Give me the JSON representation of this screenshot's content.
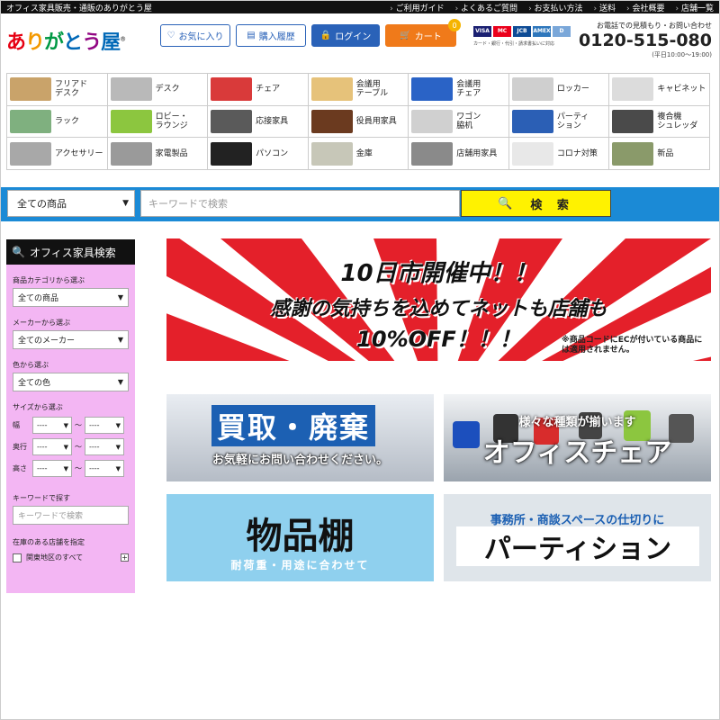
{
  "topbar": {
    "tagline": "オフィス家具販売・通販のありがとう屋",
    "links": [
      "ご利用ガイド",
      "よくあるご質問",
      "お支払い方法",
      "送料",
      "会社概要",
      "店舗一覧"
    ]
  },
  "header": {
    "logo": {
      "a": "あ",
      "ri": "り",
      "ga": "が",
      "to": "と",
      "u": "う",
      "ya": "屋",
      "mark": "®"
    },
    "fav_label": "お気に入り",
    "history_label": "購入履歴",
    "login_label": "ログイン",
    "cart_label": "カート",
    "cart_count": "0",
    "cards": [
      "VISA",
      "MC",
      "JCB",
      "AMEX",
      "D"
    ],
    "card_note": "カード・銀行・代引・請求書払いに対応",
    "phone_label": "お電話での見積もり・お問い合わせ",
    "phone_number": "0120-515-080",
    "phone_hours": "(平日10:00～19:00)"
  },
  "categories": [
    {
      "label": "フリアド\nデスク",
      "color": "#c9a36a"
    },
    {
      "label": "デスク",
      "color": "#b9b9b9"
    },
    {
      "label": "チェア",
      "color": "#d93a3a"
    },
    {
      "label": "会議用\nテーブル",
      "color": "#e6c27a"
    },
    {
      "label": "会議用\nチェア",
      "color": "#2a63c6"
    },
    {
      "label": "ロッカー",
      "color": "#cfcfcf"
    },
    {
      "label": "キャビネット",
      "color": "#dcdcdc"
    },
    {
      "label": "ラック",
      "color": "#7fb07f"
    },
    {
      "label": "ロビー・\nラウンジ",
      "color": "#8cc63f"
    },
    {
      "label": "応接家具",
      "color": "#5a5a5a"
    },
    {
      "label": "役員用家具",
      "color": "#6b3a1f"
    },
    {
      "label": "ワゴン\n脇机",
      "color": "#d0d0d0"
    },
    {
      "label": "パーティ\nション",
      "color": "#2b5fb5"
    },
    {
      "label": "複合機\nシュレッダ",
      "color": "#4a4a4a"
    },
    {
      "label": "アクセサリー",
      "color": "#a8a8a8"
    },
    {
      "label": "家電製品",
      "color": "#9a9a9a"
    },
    {
      "label": "パソコン",
      "color": "#222222"
    },
    {
      "label": "金庫",
      "color": "#c7c7b8"
    },
    {
      "label": "店舗用家具",
      "color": "#8a8a8a"
    },
    {
      "label": "コロナ対策",
      "color": "#e8e8e8"
    },
    {
      "label": "新品",
      "color": "#8a9a6a"
    }
  ],
  "search": {
    "category_value": "全ての商品",
    "keyword_placeholder": "キーワードで検索",
    "button_label": "検 索"
  },
  "sidebar": {
    "title": "オフィス家具検索",
    "category_label": "商品カテゴリから選ぶ",
    "category_value": "全ての商品",
    "maker_label": "メーカーから選ぶ",
    "maker_value": "全てのメーカー",
    "color_label": "色から選ぶ",
    "color_value": "全ての色",
    "size_label": "サイズから選ぶ",
    "size_rows": [
      {
        "dim": "幅",
        "from": "----",
        "to": "----"
      },
      {
        "dim": "奥行",
        "from": "----",
        "to": "----"
      },
      {
        "dim": "高さ",
        "from": "----",
        "to": "----"
      }
    ],
    "tilde": "～",
    "keyword_label": "キーワードで探す",
    "keyword_placeholder": "キーワードで検索",
    "store_label": "在庫のある店舗を指定",
    "store_option": "関東地区のすべて"
  },
  "banners": {
    "main": {
      "line1": "10日市開催中！！",
      "line2": "感謝の気持ちを込めてネットも店舗も",
      "line3": "10%OFF！！！",
      "note": "※商品コードにECが付いている商品には適用されません。"
    },
    "kaitori": {
      "title": "買取・廃棄",
      "sub": "お気軽にお問い合わせください。"
    },
    "chair": {
      "sub": "様々な種類が揃います",
      "title": "オフィスチェア"
    },
    "shelf": {
      "title": "物品棚",
      "sub": "耐荷重・用途に合わせて"
    },
    "partition": {
      "sub": "事務所・商談スペースの仕切りに",
      "title": "パーティション"
    }
  }
}
